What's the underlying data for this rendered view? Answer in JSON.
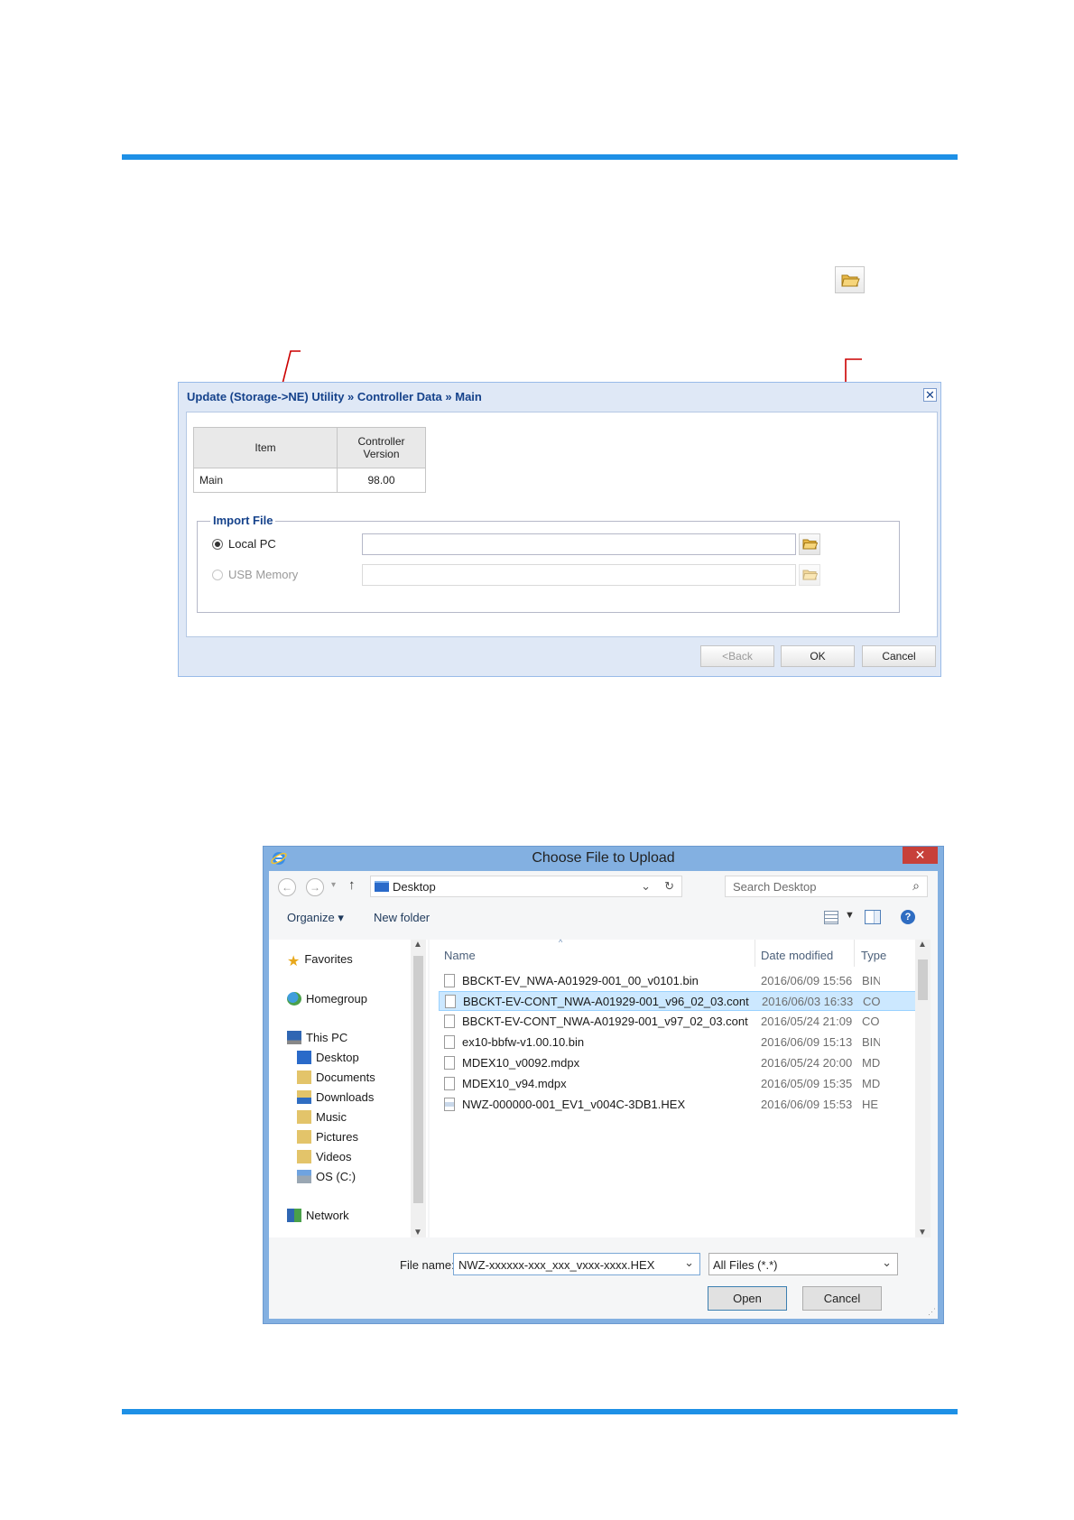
{
  "colors": {
    "rule": "#1e90e6",
    "arrow": "#cc0000",
    "dialog_title": "#15428b"
  },
  "top_icon": "folder-open-icon",
  "dialog1": {
    "title": "Update (Storage->NE) Utility » Controller Data » Main",
    "close_glyph": "✕",
    "table": {
      "col_item": "Item",
      "col_version": "Controller Version",
      "rows": [
        {
          "item": "Main",
          "version": "98.00"
        }
      ]
    },
    "import_legend": "Import File",
    "options": [
      {
        "label": "Local PC",
        "selected": true,
        "enabled": true
      },
      {
        "label": "USB Memory",
        "selected": false,
        "enabled": false
      }
    ],
    "buttons": {
      "back": "<Back",
      "ok": "OK",
      "cancel": "Cancel"
    }
  },
  "dialog2": {
    "title": "Choose File to Upload",
    "close_glyph": "✕",
    "address": "Desktop",
    "search_placeholder": "Search Desktop",
    "toolbar": {
      "organize": "Organize ▾",
      "new_folder": "New folder"
    },
    "nav": {
      "favorites": "Favorites",
      "homegroup": "Homegroup",
      "this_pc": "This PC",
      "desktop": "Desktop",
      "documents": "Documents",
      "downloads": "Downloads",
      "music": "Music",
      "pictures": "Pictures",
      "videos": "Videos",
      "os": "OS (C:)",
      "network": "Network"
    },
    "columns": {
      "name": "Name",
      "date": "Date modified",
      "type": "Type"
    },
    "files": [
      {
        "name": "BBCKT-EV_NWA-A01929-001_00_v0101.bin",
        "date": "2016/06/09 15:56",
        "type": "BIN"
      },
      {
        "name": "BBCKT-EV-CONT_NWA-A01929-001_v96_02_03.cont",
        "date": "2016/06/03 16:33",
        "type": "CO"
      },
      {
        "name": "BBCKT-EV-CONT_NWA-A01929-001_v97_02_03.cont",
        "date": "2016/05/24 21:09",
        "type": "CO"
      },
      {
        "name": "ex10-bbfw-v1.00.10.bin",
        "date": "2016/06/09 15:13",
        "type": "BIN"
      },
      {
        "name": "MDEX10_v0092.mdpx",
        "date": "2016/05/24 20:00",
        "type": "MD"
      },
      {
        "name": "MDEX10_v94.mdpx",
        "date": "2016/05/09 15:35",
        "type": "MD"
      },
      {
        "name": "NWZ-000000-001_EV1_v004C-3DB1.HEX",
        "date": "2016/06/09 15:53",
        "type": "HE"
      }
    ],
    "file_name_label": "File name:",
    "file_name_value": "NWZ-xxxxxx-xxx_xxx_vxxx-xxxx.HEX",
    "filter": "All Files (*.*)",
    "buttons": {
      "open": "Open",
      "cancel": "Cancel"
    }
  }
}
